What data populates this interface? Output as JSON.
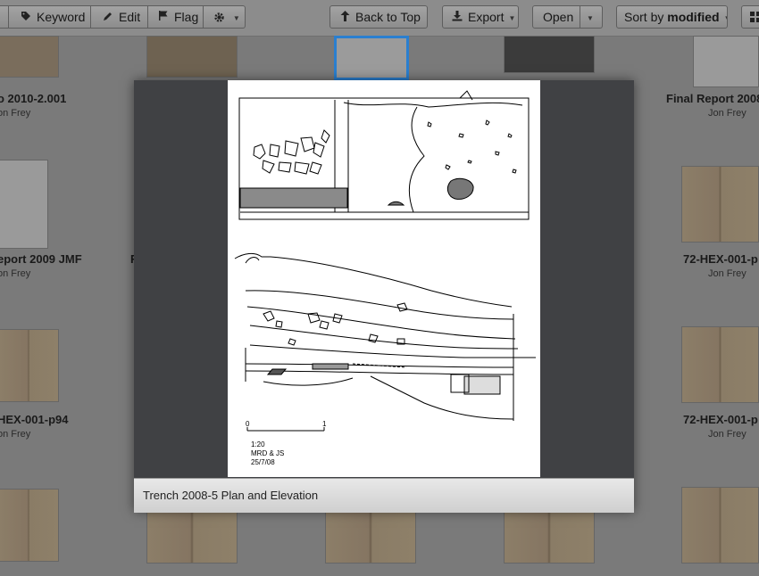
{
  "toolbar": {
    "keyword_label": "Keyword",
    "edit_label": "Edit",
    "flag_label": "Flag",
    "back_to_top_label": "Back to Top",
    "export_label": "Export",
    "open_label": "Open",
    "sort_prefix": "Sort by",
    "sort_value": "modified"
  },
  "grid": {
    "row1": [
      {
        "title": "o 2010-2.001",
        "author": "on Frey"
      },
      {
        "title": "Final Report 2008",
        "author": "Jon Frey"
      }
    ],
    "row2": [
      {
        "title": "eport 2009 JMF",
        "author": "on Frey"
      },
      {
        "title": "F",
        "author": ""
      },
      {
        "title": "72-HEX-001-p",
        "author": "Jon Frey"
      }
    ],
    "row3": [
      {
        "title": "HEX-001-p94",
        "author": "on Frey"
      },
      {
        "title": "72-HEX-001-p",
        "author": "Jon Frey"
      }
    ]
  },
  "viewer": {
    "caption": "Trench 2008-5 Plan and Elevation",
    "drawing": {
      "scale_start": "0",
      "scale_end": "1",
      "scale_ratio": "1:20",
      "authors": "MRD & JS",
      "date": "25/7/08"
    }
  },
  "icons": {
    "keyword": "tag-icon",
    "edit": "pencil-icon",
    "flag": "flag-icon",
    "settings": "gear-icon",
    "back_to_top": "arrow-up-icon",
    "export": "export-icon",
    "grid_view": "grid-view-icon"
  }
}
